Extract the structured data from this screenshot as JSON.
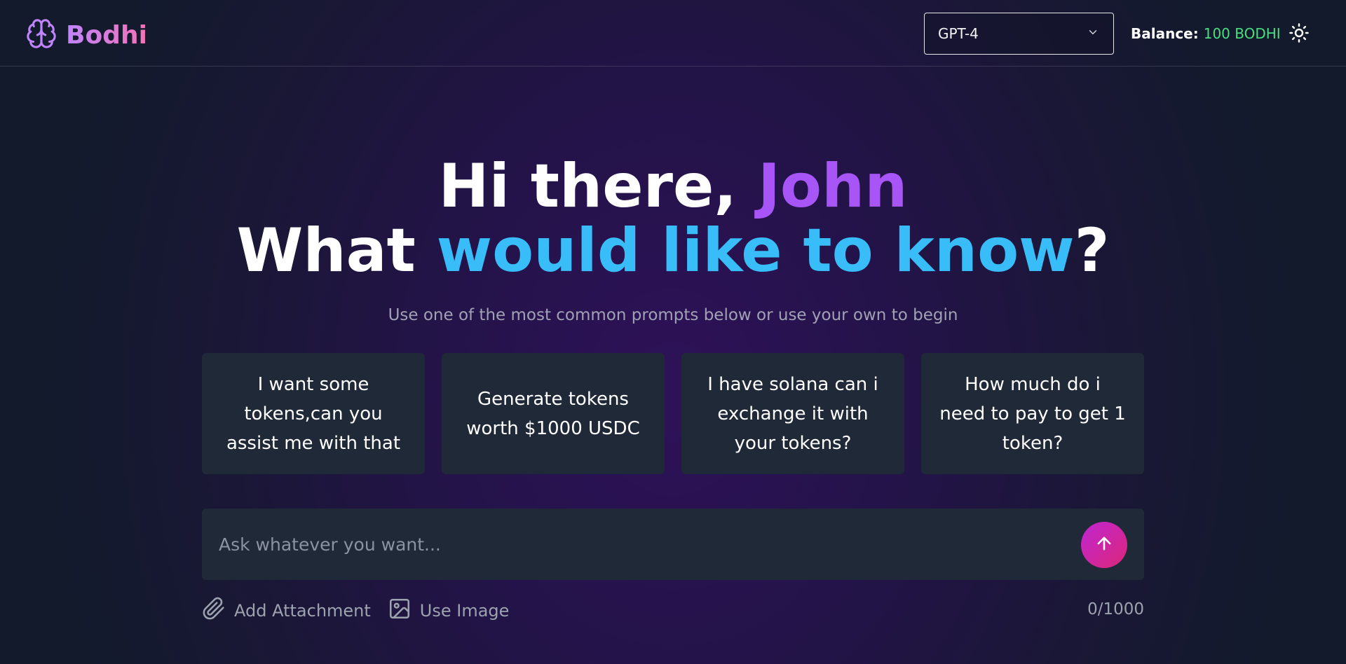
{
  "header": {
    "brand": "Bodhi",
    "logo_icon": "brain-icon",
    "model_select": {
      "selected": "GPT-4"
    },
    "balance_label": "Balance:",
    "balance_value": "100 BODHI",
    "theme_icon": "sun-icon"
  },
  "hero": {
    "greeting_prefix": "Hi there, ",
    "user_name": "John",
    "question_prefix": "What ",
    "question_highlight": "would like to know",
    "question_suffix": "?"
  },
  "subtitle": "Use one of the most common prompts below or use your own to begin",
  "prompts": [
    "I want some tokens,can you assist me with that",
    "Generate tokens worth $1000 USDC",
    "I have solana can i exchange it with your tokens?",
    "How much do i need to pay to get 1 token?"
  ],
  "composer": {
    "placeholder": "Ask whatever you want...",
    "send_icon": "arrow-up-icon",
    "attachment_label": "Add Attachment",
    "image_label": "Use Image",
    "char_count": "0/1000"
  },
  "colors": {
    "accent_purple": "#a855f7",
    "accent_blue": "#38bdf8",
    "balance_green": "#4ade80",
    "send_gradient_start": "#c026d3",
    "send_gradient_end": "#db2777"
  }
}
